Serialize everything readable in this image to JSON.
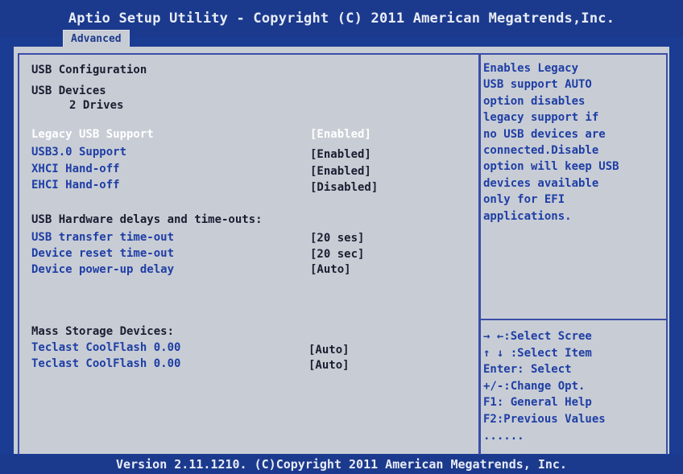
{
  "header": {
    "title": "Aptio Setup Utility - Copyright (C) 2011 American Megatrends,Inc."
  },
  "tabs": [
    {
      "label": "Advanced"
    }
  ],
  "main": {
    "section_title": "USB Configuration",
    "devices_heading": "USB Devices",
    "devices_count": "2 Drives",
    "options": [
      {
        "label": "Legacy USB Support",
        "value": "[Enabled]"
      },
      {
        "label": "USB3.0 Support",
        "value": "[Enabled]"
      },
      {
        "label": "XHCI Hand-off",
        "value": "[Enabled]"
      },
      {
        "label": "EHCI Hand-off",
        "value": "[Disabled]"
      }
    ],
    "delays_heading": "USB Hardware delays and time-outs:",
    "delays": [
      {
        "label": "USB transfer time-out",
        "value": "[20 ses]"
      },
      {
        "label": "Device reset time-out",
        "value": "[20 sec]"
      },
      {
        "label": "Device power-up delay",
        "value": "[Auto]"
      }
    ],
    "mass_heading": "Mass Storage Devices:",
    "mass": [
      {
        "label": "Teclast CoolFlash 0.00",
        "value": "[Auto]"
      },
      {
        "label": "Teclast CoolFlash 0.00",
        "value": "[Auto]"
      }
    ]
  },
  "help": {
    "description_lines": [
      "Enables Legacy",
      "USB support AUTO",
      "option disables",
      "legacy support if",
      "no USB devices are",
      "connected.Disable",
      "option will keep USB",
      "devices available",
      "only for EFI",
      "applications."
    ],
    "keys": [
      "→ ←:Select Scree",
      "↑ ↓ :Select Item",
      "Enter: Select",
      "+/-:Change Opt.",
      "F1: General Help",
      "F2:Previous Values",
      "......"
    ]
  },
  "footer": {
    "text": "Version 2.11.1210. (C)Copyright 2011 American Megatrends, Inc."
  },
  "colors": {
    "background": "#1a3c92",
    "panel": "#c8cdd5",
    "accent": "#1f3ea5",
    "selected": "#ffffff"
  }
}
